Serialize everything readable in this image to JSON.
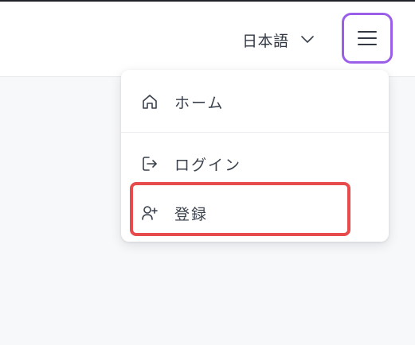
{
  "header": {
    "language": "日本語",
    "language_icon": "chevron-down-icon",
    "menu_icon": "hamburger-menu-icon"
  },
  "dropdown": {
    "items": [
      {
        "label": "ホーム",
        "icon": "home-icon"
      },
      {
        "label": "ログイン",
        "icon": "login-icon"
      },
      {
        "label": "登録",
        "icon": "user-plus-icon"
      }
    ]
  },
  "colors": {
    "menu_button_border": "#9a5ee8",
    "highlight_border": "#e84b4b",
    "page_background": "#f7f8fa"
  }
}
